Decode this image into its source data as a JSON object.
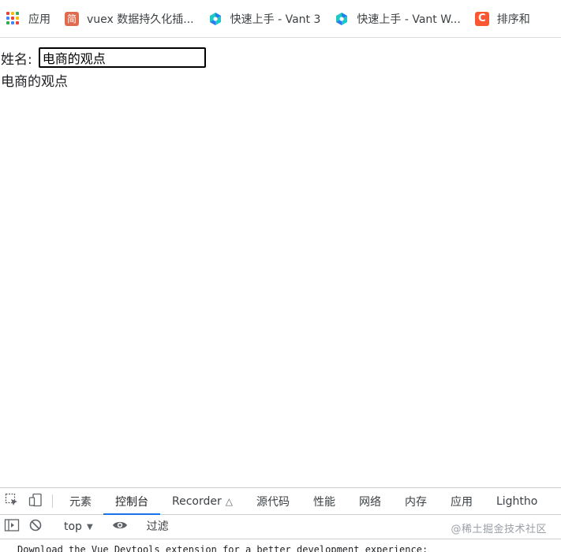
{
  "bookmarks": [
    {
      "label": "应用",
      "icon": "apps-grid-icon"
    },
    {
      "label": "vuex 数据持久化插...",
      "icon": "jianshu-icon",
      "icon_text": "简"
    },
    {
      "label": "快速上手 - Vant 3",
      "icon": "vant-icon"
    },
    {
      "label": "快速上手 - Vant W...",
      "icon": "vant-icon"
    },
    {
      "label": "排序和",
      "icon": "csdn-icon",
      "icon_text": "C"
    }
  ],
  "form": {
    "label": "姓名:",
    "input_value": "电商的观点"
  },
  "output_text": "电商的观点",
  "devtools": {
    "tabs": [
      {
        "label": "元素",
        "active": false
      },
      {
        "label": "控制台",
        "active": true
      },
      {
        "label": "Recorder",
        "active": false
      },
      {
        "label": "源代码",
        "active": false
      },
      {
        "label": "性能",
        "active": false
      },
      {
        "label": "网络",
        "active": false
      },
      {
        "label": "内存",
        "active": false
      },
      {
        "label": "应用",
        "active": false
      },
      {
        "label": "Lightho",
        "active": false
      }
    ],
    "context": "top",
    "filter_placeholder": "过滤",
    "watermark": "@稀土掘金技术社区",
    "console_message": "Download the Vue Devtools extension for a better development experience:"
  },
  "colors": {
    "active_tab_underline": "#1a73e8",
    "vant_teal": "#1fc8c8",
    "vant_blue": "#2b7bf0",
    "jianshu_red": "#e06a4e",
    "csdn_orange": "#fc5531"
  }
}
